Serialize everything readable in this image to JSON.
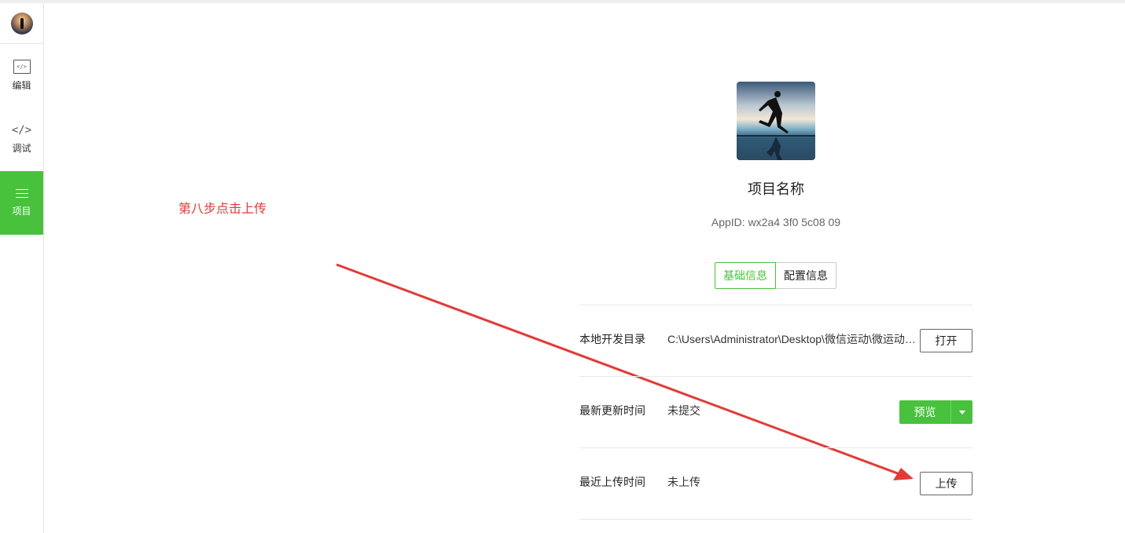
{
  "sidebar": {
    "items": [
      {
        "label": "编辑",
        "icon": "editor-icon",
        "active": false
      },
      {
        "label": "调试",
        "icon": "code-icon",
        "active": false
      },
      {
        "label": "项目",
        "icon": "menu-icon",
        "active": true
      }
    ]
  },
  "annotation": {
    "text": "第八步点击上传",
    "color": "#e53935"
  },
  "project": {
    "name": "项目名称",
    "appid": "AppID: wx2a4 3f0 5c08 09"
  },
  "tabs": [
    {
      "label": "基础信息",
      "active": true
    },
    {
      "label": "配置信息",
      "active": false
    }
  ],
  "rows": {
    "local_dir": {
      "label": "本地开发目录",
      "value": "C:\\Users\\Administrator\\Desktop\\微信运动\\微运动…",
      "button": "打开"
    },
    "updated": {
      "label": "最新更新时间",
      "value": "未提交",
      "button": "预览"
    },
    "uploaded": {
      "label": "最近上传时间",
      "value": "未上传",
      "button": "上传"
    }
  },
  "colors": {
    "accent": "#48c23d",
    "annotation": "#e53935"
  }
}
